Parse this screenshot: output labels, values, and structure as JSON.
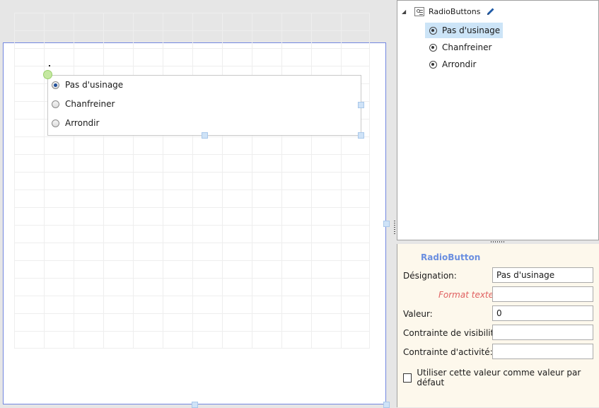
{
  "designer": {
    "radio_group": {
      "options": [
        {
          "label": "Pas d'usinage",
          "checked": true
        },
        {
          "label": "Chanfreiner",
          "checked": false
        },
        {
          "label": "Arrondir",
          "checked": false
        }
      ]
    }
  },
  "tree": {
    "root_label": "RadioButtons",
    "items": [
      {
        "label": "Pas d'usinage",
        "selected": true
      },
      {
        "label": "Chanfreiner",
        "selected": false
      },
      {
        "label": "Arrondir",
        "selected": false
      }
    ]
  },
  "properties": {
    "title": "RadioButton",
    "designation_label": "Désignation:",
    "designation_value": "Pas d'usinage",
    "format_label": "Format texte :",
    "format_value": "",
    "value_label": "Valeur:",
    "value_value": "0",
    "visibility_label": "Contrainte de visibilité:",
    "visibility_value": "",
    "activity_label": "Contrainte d'activité:",
    "activity_value": "",
    "default_checkbox_label": "Utiliser cette valeur comme valeur par défaut",
    "default_checked": false
  },
  "colors": {
    "accent_blue": "#7286e0",
    "selection": "#cce4f7",
    "panel_bg": "#fdf8ec",
    "format_label": "#e06060",
    "title_blue": "#6b8fe0"
  },
  "icons": {
    "tree_toggle": "collapse-triangle-icon",
    "tree_root": "radio-group-icon",
    "edit": "pencil-icon",
    "tree_item": "radio-button-icon"
  }
}
